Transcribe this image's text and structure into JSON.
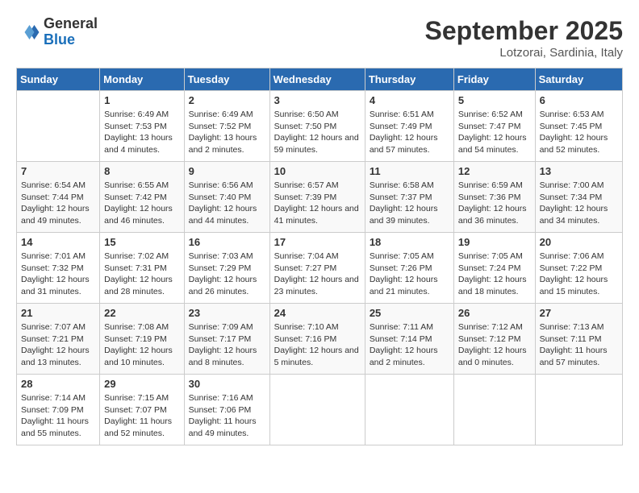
{
  "header": {
    "logo_line1": "General",
    "logo_line2": "Blue",
    "month_year": "September 2025",
    "location": "Lotzorai, Sardinia, Italy"
  },
  "weekdays": [
    "Sunday",
    "Monday",
    "Tuesday",
    "Wednesday",
    "Thursday",
    "Friday",
    "Saturday"
  ],
  "weeks": [
    [
      {
        "day": "",
        "sunrise": "",
        "sunset": "",
        "daylight": ""
      },
      {
        "day": "1",
        "sunrise": "Sunrise: 6:49 AM",
        "sunset": "Sunset: 7:53 PM",
        "daylight": "Daylight: 13 hours and 4 minutes."
      },
      {
        "day": "2",
        "sunrise": "Sunrise: 6:49 AM",
        "sunset": "Sunset: 7:52 PM",
        "daylight": "Daylight: 13 hours and 2 minutes."
      },
      {
        "day": "3",
        "sunrise": "Sunrise: 6:50 AM",
        "sunset": "Sunset: 7:50 PM",
        "daylight": "Daylight: 12 hours and 59 minutes."
      },
      {
        "day": "4",
        "sunrise": "Sunrise: 6:51 AM",
        "sunset": "Sunset: 7:49 PM",
        "daylight": "Daylight: 12 hours and 57 minutes."
      },
      {
        "day": "5",
        "sunrise": "Sunrise: 6:52 AM",
        "sunset": "Sunset: 7:47 PM",
        "daylight": "Daylight: 12 hours and 54 minutes."
      },
      {
        "day": "6",
        "sunrise": "Sunrise: 6:53 AM",
        "sunset": "Sunset: 7:45 PM",
        "daylight": "Daylight: 12 hours and 52 minutes."
      }
    ],
    [
      {
        "day": "7",
        "sunrise": "Sunrise: 6:54 AM",
        "sunset": "Sunset: 7:44 PM",
        "daylight": "Daylight: 12 hours and 49 minutes."
      },
      {
        "day": "8",
        "sunrise": "Sunrise: 6:55 AM",
        "sunset": "Sunset: 7:42 PM",
        "daylight": "Daylight: 12 hours and 46 minutes."
      },
      {
        "day": "9",
        "sunrise": "Sunrise: 6:56 AM",
        "sunset": "Sunset: 7:40 PM",
        "daylight": "Daylight: 12 hours and 44 minutes."
      },
      {
        "day": "10",
        "sunrise": "Sunrise: 6:57 AM",
        "sunset": "Sunset: 7:39 PM",
        "daylight": "Daylight: 12 hours and 41 minutes."
      },
      {
        "day": "11",
        "sunrise": "Sunrise: 6:58 AM",
        "sunset": "Sunset: 7:37 PM",
        "daylight": "Daylight: 12 hours and 39 minutes."
      },
      {
        "day": "12",
        "sunrise": "Sunrise: 6:59 AM",
        "sunset": "Sunset: 7:36 PM",
        "daylight": "Daylight: 12 hours and 36 minutes."
      },
      {
        "day": "13",
        "sunrise": "Sunrise: 7:00 AM",
        "sunset": "Sunset: 7:34 PM",
        "daylight": "Daylight: 12 hours and 34 minutes."
      }
    ],
    [
      {
        "day": "14",
        "sunrise": "Sunrise: 7:01 AM",
        "sunset": "Sunset: 7:32 PM",
        "daylight": "Daylight: 12 hours and 31 minutes."
      },
      {
        "day": "15",
        "sunrise": "Sunrise: 7:02 AM",
        "sunset": "Sunset: 7:31 PM",
        "daylight": "Daylight: 12 hours and 28 minutes."
      },
      {
        "day": "16",
        "sunrise": "Sunrise: 7:03 AM",
        "sunset": "Sunset: 7:29 PM",
        "daylight": "Daylight: 12 hours and 26 minutes."
      },
      {
        "day": "17",
        "sunrise": "Sunrise: 7:04 AM",
        "sunset": "Sunset: 7:27 PM",
        "daylight": "Daylight: 12 hours and 23 minutes."
      },
      {
        "day": "18",
        "sunrise": "Sunrise: 7:05 AM",
        "sunset": "Sunset: 7:26 PM",
        "daylight": "Daylight: 12 hours and 21 minutes."
      },
      {
        "day": "19",
        "sunrise": "Sunrise: 7:05 AM",
        "sunset": "Sunset: 7:24 PM",
        "daylight": "Daylight: 12 hours and 18 minutes."
      },
      {
        "day": "20",
        "sunrise": "Sunrise: 7:06 AM",
        "sunset": "Sunset: 7:22 PM",
        "daylight": "Daylight: 12 hours and 15 minutes."
      }
    ],
    [
      {
        "day": "21",
        "sunrise": "Sunrise: 7:07 AM",
        "sunset": "Sunset: 7:21 PM",
        "daylight": "Daylight: 12 hours and 13 minutes."
      },
      {
        "day": "22",
        "sunrise": "Sunrise: 7:08 AM",
        "sunset": "Sunset: 7:19 PM",
        "daylight": "Daylight: 12 hours and 10 minutes."
      },
      {
        "day": "23",
        "sunrise": "Sunrise: 7:09 AM",
        "sunset": "Sunset: 7:17 PM",
        "daylight": "Daylight: 12 hours and 8 minutes."
      },
      {
        "day": "24",
        "sunrise": "Sunrise: 7:10 AM",
        "sunset": "Sunset: 7:16 PM",
        "daylight": "Daylight: 12 hours and 5 minutes."
      },
      {
        "day": "25",
        "sunrise": "Sunrise: 7:11 AM",
        "sunset": "Sunset: 7:14 PM",
        "daylight": "Daylight: 12 hours and 2 minutes."
      },
      {
        "day": "26",
        "sunrise": "Sunrise: 7:12 AM",
        "sunset": "Sunset: 7:12 PM",
        "daylight": "Daylight: 12 hours and 0 minutes."
      },
      {
        "day": "27",
        "sunrise": "Sunrise: 7:13 AM",
        "sunset": "Sunset: 7:11 PM",
        "daylight": "Daylight: 11 hours and 57 minutes."
      }
    ],
    [
      {
        "day": "28",
        "sunrise": "Sunrise: 7:14 AM",
        "sunset": "Sunset: 7:09 PM",
        "daylight": "Daylight: 11 hours and 55 minutes."
      },
      {
        "day": "29",
        "sunrise": "Sunrise: 7:15 AM",
        "sunset": "Sunset: 7:07 PM",
        "daylight": "Daylight: 11 hours and 52 minutes."
      },
      {
        "day": "30",
        "sunrise": "Sunrise: 7:16 AM",
        "sunset": "Sunset: 7:06 PM",
        "daylight": "Daylight: 11 hours and 49 minutes."
      },
      {
        "day": "",
        "sunrise": "",
        "sunset": "",
        "daylight": ""
      },
      {
        "day": "",
        "sunrise": "",
        "sunset": "",
        "daylight": ""
      },
      {
        "day": "",
        "sunrise": "",
        "sunset": "",
        "daylight": ""
      },
      {
        "day": "",
        "sunrise": "",
        "sunset": "",
        "daylight": ""
      }
    ]
  ]
}
